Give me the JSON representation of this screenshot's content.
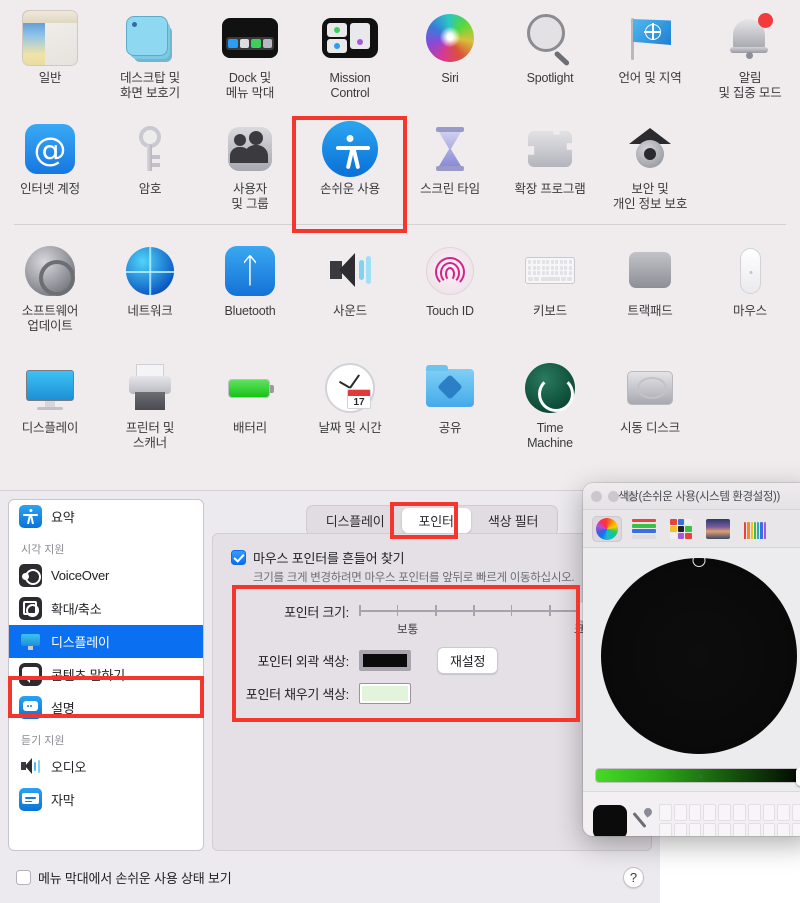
{
  "system_preferences": {
    "rows": [
      [
        {
          "label": "일반",
          "icon": "general-icon"
        },
        {
          "label": "데스크탑 및\n화면 보호기",
          "icon": "desktop-screensaver-icon"
        },
        {
          "label": "Dock 및\n메뉴 막대",
          "icon": "dock-menubar-icon"
        },
        {
          "label": "Mission\nControl",
          "icon": "mission-control-icon"
        },
        {
          "label": "Siri",
          "icon": "siri-icon"
        },
        {
          "label": "Spotlight",
          "icon": "spotlight-icon"
        },
        {
          "label": "언어 및 지역",
          "icon": "language-region-icon"
        },
        {
          "label": "알림\n및 집중 모드",
          "icon": "notifications-focus-icon"
        }
      ],
      [
        {
          "label": "인터넷 계정",
          "icon": "internet-accounts-icon"
        },
        {
          "label": "암호",
          "icon": "passwords-key-icon"
        },
        {
          "label": "사용자\n및 그룹",
          "icon": "users-groups-icon"
        },
        {
          "label": "손쉬운 사용",
          "icon": "accessibility-icon"
        },
        {
          "label": "스크린 타임",
          "icon": "screen-time-icon"
        },
        {
          "label": "확장 프로그램",
          "icon": "extensions-puzzle-icon"
        },
        {
          "label": "보안 및\n개인 정보 보호",
          "icon": "security-privacy-icon"
        }
      ],
      [
        {
          "label": "소프트웨어\n업데이트",
          "icon": "software-update-icon"
        },
        {
          "label": "네트워크",
          "icon": "network-globe-icon"
        },
        {
          "label": "Bluetooth",
          "icon": "bluetooth-icon"
        },
        {
          "label": "사운드",
          "icon": "sound-icon"
        },
        {
          "label": "Touch ID",
          "icon": "touch-id-icon"
        },
        {
          "label": "키보드",
          "icon": "keyboard-icon"
        },
        {
          "label": "트랙패드",
          "icon": "trackpad-icon"
        },
        {
          "label": "마우스",
          "icon": "mouse-icon"
        }
      ],
      [
        {
          "label": "디스플레이",
          "icon": "displays-icon"
        },
        {
          "label": "프린터 및\n스캐너",
          "icon": "printers-scanners-icon"
        },
        {
          "label": "배터리",
          "icon": "battery-icon"
        },
        {
          "label": "날짜 및 시간",
          "icon": "date-time-icon"
        },
        {
          "label": "공유",
          "icon": "sharing-folder-icon"
        },
        {
          "label": "Time\nMachine",
          "icon": "time-machine-icon"
        },
        {
          "label": "시동 디스크",
          "icon": "startup-disk-icon"
        }
      ]
    ]
  },
  "accessibility": {
    "sidebar": {
      "items": [
        {
          "label": "요약",
          "icon": "accessibility-summary-icon",
          "selected": false,
          "group": null
        },
        {
          "label": "시각 지원",
          "group_header": true
        },
        {
          "label": "VoiceOver",
          "icon": "voiceover-icon",
          "selected": false
        },
        {
          "label": "확대/축소",
          "icon": "zoom-icon",
          "selected": false
        },
        {
          "label": "디스플레이",
          "icon": "display-icon",
          "selected": true
        },
        {
          "label": "콘텐츠 말하기",
          "icon": "spoken-content-icon",
          "selected": false
        },
        {
          "label": "설명",
          "icon": "descriptions-icon",
          "selected": false
        },
        {
          "label": "듣기 지원",
          "group_header": true
        },
        {
          "label": "오디오",
          "icon": "audio-icon",
          "selected": false
        },
        {
          "label": "자막",
          "icon": "captions-icon",
          "selected": false
        }
      ]
    },
    "tabs": [
      {
        "label": "디스플레이",
        "selected": false
      },
      {
        "label": "포인터",
        "selected": true
      },
      {
        "label": "색상 필터",
        "selected": false
      }
    ],
    "pointer": {
      "shake_checkbox_label": "마우스 포인터를 흔들어 찾기",
      "shake_checkbox_checked": true,
      "shake_hint": "크기를 크게 변경하려면 마우스 포인터를 앞뒤로 빠르게 이동하십시오.",
      "size_label": "포인터 크기:",
      "size_min_label": "보통",
      "size_max_label": "크게",
      "size_ticks": 7,
      "size_value_percent": 100,
      "outline_color_label": "포인터 외곽 색상:",
      "outline_color_value": "#0b0b0b",
      "fill_color_label": "포인터 채우기 색상:",
      "fill_color_value": "#e2f5dc",
      "reset_button_label": "재설정"
    },
    "footer": {
      "menubar_checkbox_label": "메뉴 막대에서 손쉬운 사용 상태 보기",
      "menubar_checkbox_checked": false,
      "help_button_label": "?"
    }
  },
  "color_picker": {
    "title": "색상(손쉬운 사용(시스템 환경설정))",
    "toolbar": [
      {
        "name": "color-wheel-tab",
        "selected": true
      },
      {
        "name": "color-sliders-tab",
        "selected": false
      },
      {
        "name": "color-palettes-tab",
        "selected": false
      },
      {
        "name": "image-palettes-tab",
        "selected": false
      },
      {
        "name": "pencils-tab",
        "selected": false
      }
    ],
    "selected_color": "#0b0b0b",
    "brightness_percent": 100,
    "wheel_marker_position": "top",
    "swatch_count": 20
  },
  "annotations": {
    "accent_color": "#f4372e",
    "boxes": [
      {
        "name": "accessibility-pref-highlight"
      },
      {
        "name": "sidebar-display-highlight"
      },
      {
        "name": "pointer-tab-highlight"
      },
      {
        "name": "pointer-settings-highlight"
      }
    ]
  }
}
